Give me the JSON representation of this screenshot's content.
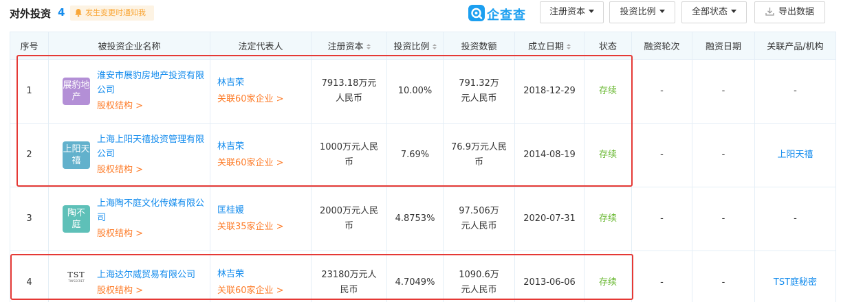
{
  "header": {
    "title": "对外投资",
    "count": "4",
    "notice": "发生变更时通知我",
    "logo_text": "企查查",
    "buttons": {
      "reg_capital": "注册资本",
      "invest_ratio": "投资比例",
      "all_status": "全部状态",
      "export": "导出数据"
    }
  },
  "colors": {
    "accent": "#128bed",
    "link_orange": "#fd7d2b",
    "status_green": "#6bb934",
    "highlight_red": "#e53935",
    "header_bg": "#f2f9fc"
  },
  "table": {
    "columns": [
      "序号",
      "被投资企业名称",
      "法定代表人",
      "注册资本",
      "投资比例",
      "投资数额",
      "成立日期",
      "状态",
      "融资轮次",
      "融资日期",
      "关联产品/机构"
    ],
    "rows": [
      {
        "index": "1",
        "logo_text": "展豹地产",
        "logo_color": "#b38fd6",
        "company": "淮安市展豹房地产投资有限公司",
        "equity_link": "股权结构 >",
        "legal_rep": "林吉荣",
        "related": "关联60家企业 >",
        "reg_capital": "7913.18万元人民币",
        "ratio": "10.00%",
        "amount": "791.32万元人民币",
        "date": "2018-12-29",
        "status": "存续",
        "round": "-",
        "fin_date": "-",
        "product": "-"
      },
      {
        "index": "2",
        "logo_text": "上阳天禧",
        "logo_color": "#62b1cc",
        "company": "上海上阳天禧投资管理有限公司",
        "equity_link": "股权结构 >",
        "legal_rep": "林吉荣",
        "related": "关联60家企业 >",
        "reg_capital": "1000万元人民币",
        "ratio": "7.69%",
        "amount": "76.9万元人民币",
        "date": "2014-08-19",
        "status": "存续",
        "round": "-",
        "fin_date": "-",
        "product": "上阳天禧"
      },
      {
        "index": "3",
        "logo_text": "陶不庭",
        "logo_color": "#5ec0b8",
        "company": "上海陶不庭文化传媒有限公司",
        "equity_link": "股权结构 >",
        "legal_rep": "匡桂媛",
        "related": "关联35家企业 >",
        "reg_capital": "2000万元人民币",
        "ratio": "4.8753%",
        "amount": "97.506万元人民币",
        "date": "2020-07-31",
        "status": "存续",
        "round": "-",
        "fin_date": "-",
        "product": "-"
      },
      {
        "index": "4",
        "logo_text": "TST",
        "logo_sub": "TIN'SECRET",
        "logo_color": "#ffffff",
        "company": "上海达尔威贸易有限公司",
        "equity_link": "股权结构 >",
        "legal_rep": "林吉荣",
        "related": "关联60家企业 >",
        "reg_capital": "23180万元人民币",
        "ratio": "4.7049%",
        "amount": "1090.6万元人民币",
        "date": "2013-06-06",
        "status": "存续",
        "round": "-",
        "fin_date": "-",
        "product": "TST庭秘密"
      }
    ]
  }
}
